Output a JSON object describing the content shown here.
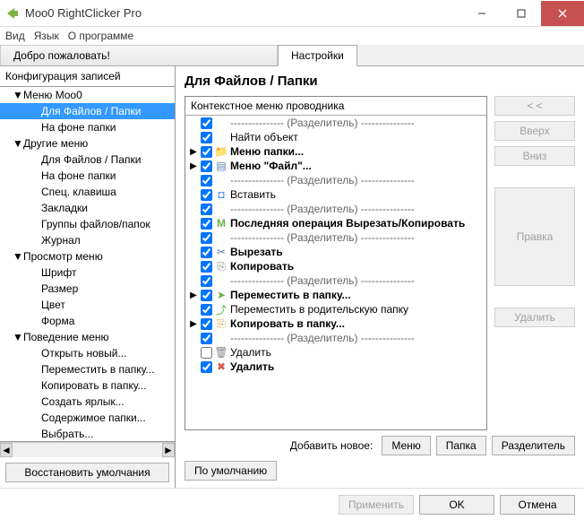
{
  "window": {
    "title": "Moo0 RightClicker Pro"
  },
  "menubar": {
    "view": "Вид",
    "language": "Язык",
    "about": "О программе"
  },
  "tabs": {
    "welcome": "Добро пожаловать!",
    "settings": "Настройки"
  },
  "left": {
    "header": "Конфигурация записей",
    "restore": "Восстановить умолчания",
    "items": [
      {
        "label": "Меню Moo0",
        "level": 1,
        "expandable": true
      },
      {
        "label": "Для Файлов / Папки",
        "level": 2,
        "selected": true
      },
      {
        "label": "На фоне папки",
        "level": 2
      },
      {
        "label": "Другие меню",
        "level": 1,
        "expandable": true
      },
      {
        "label": "Для Файлов / Папки",
        "level": 2
      },
      {
        "label": "На фоне папки",
        "level": 2
      },
      {
        "label": "Спец. клавиша",
        "level": 2
      },
      {
        "label": "Закладки",
        "level": 2
      },
      {
        "label": "Группы файлов/папок",
        "level": 2
      },
      {
        "label": "Журнал",
        "level": 2
      },
      {
        "label": "Просмотр меню",
        "level": 1,
        "expandable": true
      },
      {
        "label": "Шрифт",
        "level": 2
      },
      {
        "label": "Размер",
        "level": 2
      },
      {
        "label": "Цвет",
        "level": 2
      },
      {
        "label": "Форма",
        "level": 2
      },
      {
        "label": "Поведение меню",
        "level": 1,
        "expandable": true
      },
      {
        "label": "Открыть новый...",
        "level": 2
      },
      {
        "label": "Переместить в папку...",
        "level": 2
      },
      {
        "label": "Копировать в папку...",
        "level": 2
      },
      {
        "label": "Создать ярлык...",
        "level": 2
      },
      {
        "label": "Содержимое папки...",
        "level": 2
      },
      {
        "label": "Выбрать...",
        "level": 2
      }
    ]
  },
  "right": {
    "title": "Для Файлов / Папки",
    "list_header": "Контекстное меню проводника",
    "buttons": {
      "collapse": "< <",
      "up": "Вверх",
      "down": "Вниз",
      "edit": "Правка",
      "delete": "Удалить"
    },
    "addnew": {
      "label": "Добавить новое:",
      "menu": "Меню",
      "folder": "Папка",
      "separator": "Разделитель"
    },
    "defaults": "По умолчанию",
    "rows": [
      {
        "exp": "",
        "checked": true,
        "icon": "",
        "label": "--------------- (Разделитель) ---------------",
        "sep": true
      },
      {
        "exp": "",
        "checked": true,
        "icon": "",
        "label": "Найти объект"
      },
      {
        "exp": "▶",
        "checked": true,
        "icon": "folder",
        "label": "Меню папки...",
        "bold": true
      },
      {
        "exp": "▶",
        "checked": true,
        "icon": "file",
        "label": "Меню \"Файл\"...",
        "bold": true
      },
      {
        "exp": "",
        "checked": true,
        "icon": "",
        "label": "--------------- (Разделитель) ---------------",
        "sep": true
      },
      {
        "exp": "",
        "checked": true,
        "icon": "paste",
        "label": "Вставить"
      },
      {
        "exp": "",
        "checked": true,
        "icon": "",
        "label": "--------------- (Разделитель) ---------------",
        "sep": true
      },
      {
        "exp": "",
        "checked": true,
        "icon": "m",
        "label": "Последняя операция Вырезать/Копировать",
        "bold": true
      },
      {
        "exp": "",
        "checked": true,
        "icon": "",
        "label": "--------------- (Разделитель) ---------------",
        "sep": true
      },
      {
        "exp": "",
        "checked": true,
        "icon": "cut",
        "label": "Вырезать",
        "bold": true
      },
      {
        "exp": "",
        "checked": true,
        "icon": "copy",
        "label": "Копировать",
        "bold": true
      },
      {
        "exp": "",
        "checked": true,
        "icon": "",
        "label": "--------------- (Разделитель) ---------------",
        "sep": true
      },
      {
        "exp": "▶",
        "checked": true,
        "icon": "move",
        "label": "Переместить в папку...",
        "bold": true
      },
      {
        "exp": "",
        "checked": true,
        "icon": "moveup",
        "label": "Переместить в родительскую папку"
      },
      {
        "exp": "▶",
        "checked": true,
        "icon": "copyto",
        "label": "Копировать в папку...",
        "bold": true
      },
      {
        "exp": "",
        "checked": true,
        "icon": "",
        "label": "--------------- (Разделитель) ---------------",
        "sep": true
      },
      {
        "exp": "",
        "checked": false,
        "icon": "trash",
        "label": "Удалить"
      },
      {
        "exp": "",
        "checked": true,
        "icon": "del",
        "label": "Удалить",
        "bold": true
      }
    ]
  },
  "bottom": {
    "apply": "Применить",
    "ok": "OK",
    "cancel": "Отмена"
  }
}
